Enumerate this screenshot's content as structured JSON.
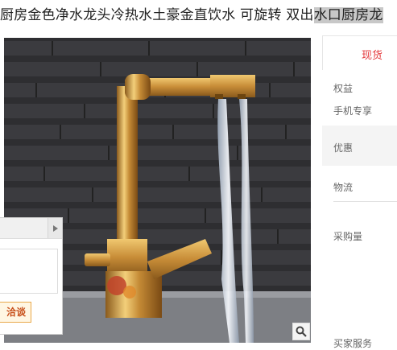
{
  "product": {
    "title_main": "厨房金色净水龙头冷热水土豪金直饮水 可旋转 双出",
    "title_highlight": "水口厨房龙",
    "image_alt": "金色厨房龙头"
  },
  "chat": {
    "button_label": "洽谈"
  },
  "sidebar": {
    "tab_label": "现货",
    "rights_label": "权益",
    "mobile_label": "手机专享",
    "coupon_label": "优惠",
    "logistics_label": "物流",
    "purchase_label": "采购量",
    "service_label": "买家服务"
  },
  "colors": {
    "accent": "#e4393c",
    "chat_button_border": "#e9a94c",
    "chat_button_bg": "#fff6e3",
    "gold": "#d4a24c"
  },
  "icons": {
    "zoom": "magnifier-icon",
    "chat_toggle": "arrow-right-icon"
  }
}
